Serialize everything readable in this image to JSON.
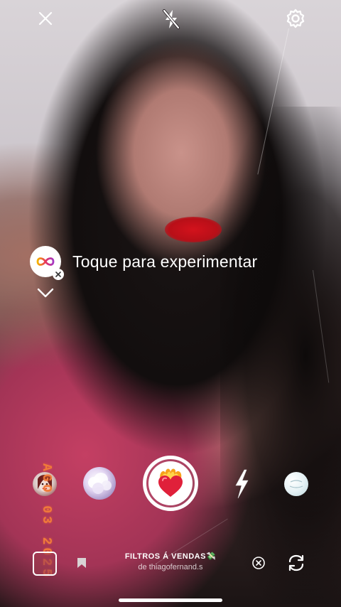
{
  "top_bar": {
    "close_icon": "close-icon",
    "flash_icon": "flash-off-icon",
    "settings_icon": "gear-icon"
  },
  "effect_prompt": {
    "label": "Toque para experimentar",
    "badge_icon": "infinity-icon",
    "remove_badge_icon": "close-icon",
    "expand_icon": "chevron-down-icon"
  },
  "date_stamp": "AGO 03 2025",
  "filters": [
    {
      "name": "filter-1",
      "icon": "face-filter-icon"
    },
    {
      "name": "filter-2",
      "icon": "clouds-filter-icon"
    },
    {
      "name": "selected-filter",
      "icon": "burning-heart-icon"
    },
    {
      "name": "filter-4",
      "icon": "lightning-filter-icon"
    },
    {
      "name": "filter-5",
      "icon": "bubble-filter-icon"
    }
  ],
  "bottom": {
    "effect_name": "FILTROS Á VENDAS💸",
    "effect_creator": "de thiagofernand.s",
    "gallery_icon": "gallery-thumbnail-icon",
    "save_icon": "bookmark-icon",
    "remove_icon": "close-circle-icon",
    "flip_icon": "flip-camera-icon"
  },
  "colors": {
    "date_stamp": "#f07a3a",
    "ui_white": "#ffffff",
    "heart_red": "#e0203a"
  }
}
